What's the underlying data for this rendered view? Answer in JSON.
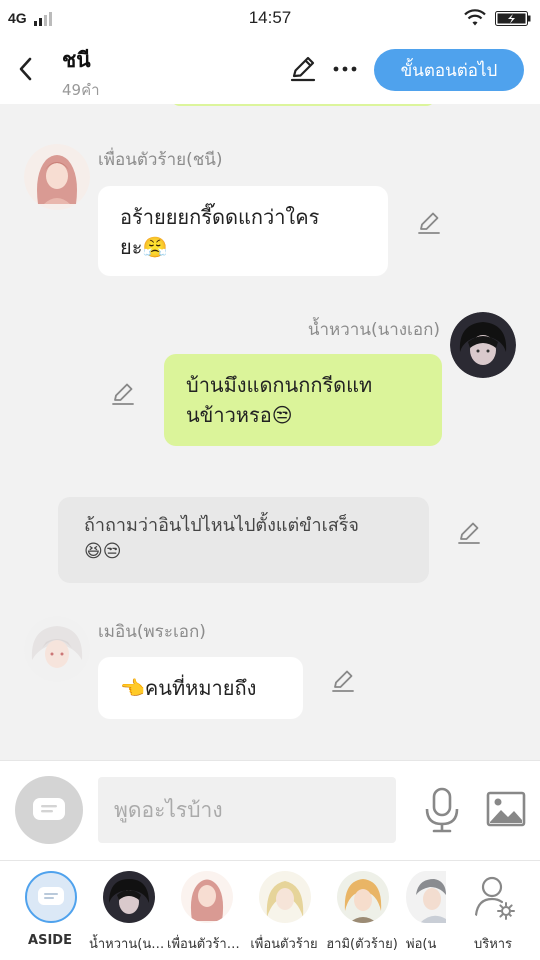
{
  "status": {
    "network": "4G",
    "time": "14:57"
  },
  "header": {
    "title": "ชนี",
    "subtitle": "49คำ",
    "next_button": "ขั้นตอนต่อไป"
  },
  "messages": [
    {
      "sender": "เพื่อนตัวร้าย(ชนี)",
      "text": "อร้ายยยกรี๊ดดแกว่าใคร\nยะ😤",
      "side": "left",
      "style": "white"
    },
    {
      "sender": "น้ำหวาน(นางเอก)",
      "text": "บ้านมึงแดกนกกรีดแท\nนข้าวหรอ😒",
      "side": "right",
      "style": "green"
    },
    {
      "sender": "",
      "text": "ถ้าถามว่าอินไปไหนไปตั้งแต่ขำเสร็จ\n😆😒",
      "side": "center",
      "style": "narration"
    },
    {
      "sender": "เมอิน(พระเอก)",
      "text": "👈คนที่หมายถึง",
      "side": "left",
      "style": "white"
    }
  ],
  "input": {
    "placeholder": "พูดอะไรบ้าง"
  },
  "characters": [
    {
      "label": "ASIDE",
      "icon": "aside-bubble-icon"
    },
    {
      "label": "น้ำหวาน(นางเอก)"
    },
    {
      "label": "เพื่อนตัวร้าย(ชนี)"
    },
    {
      "label": "เพื่อนตัวร้าย"
    },
    {
      "label": "ฮามิ(ตัวร้าย)"
    },
    {
      "label": "พ่อ(น"
    },
    {
      "label": "บริหาร",
      "icon": "manage-characters-icon"
    }
  ],
  "colors": {
    "accent": "#4fa2ed",
    "green_bubble": "#dbf49a",
    "background": "#f2f2f2"
  }
}
